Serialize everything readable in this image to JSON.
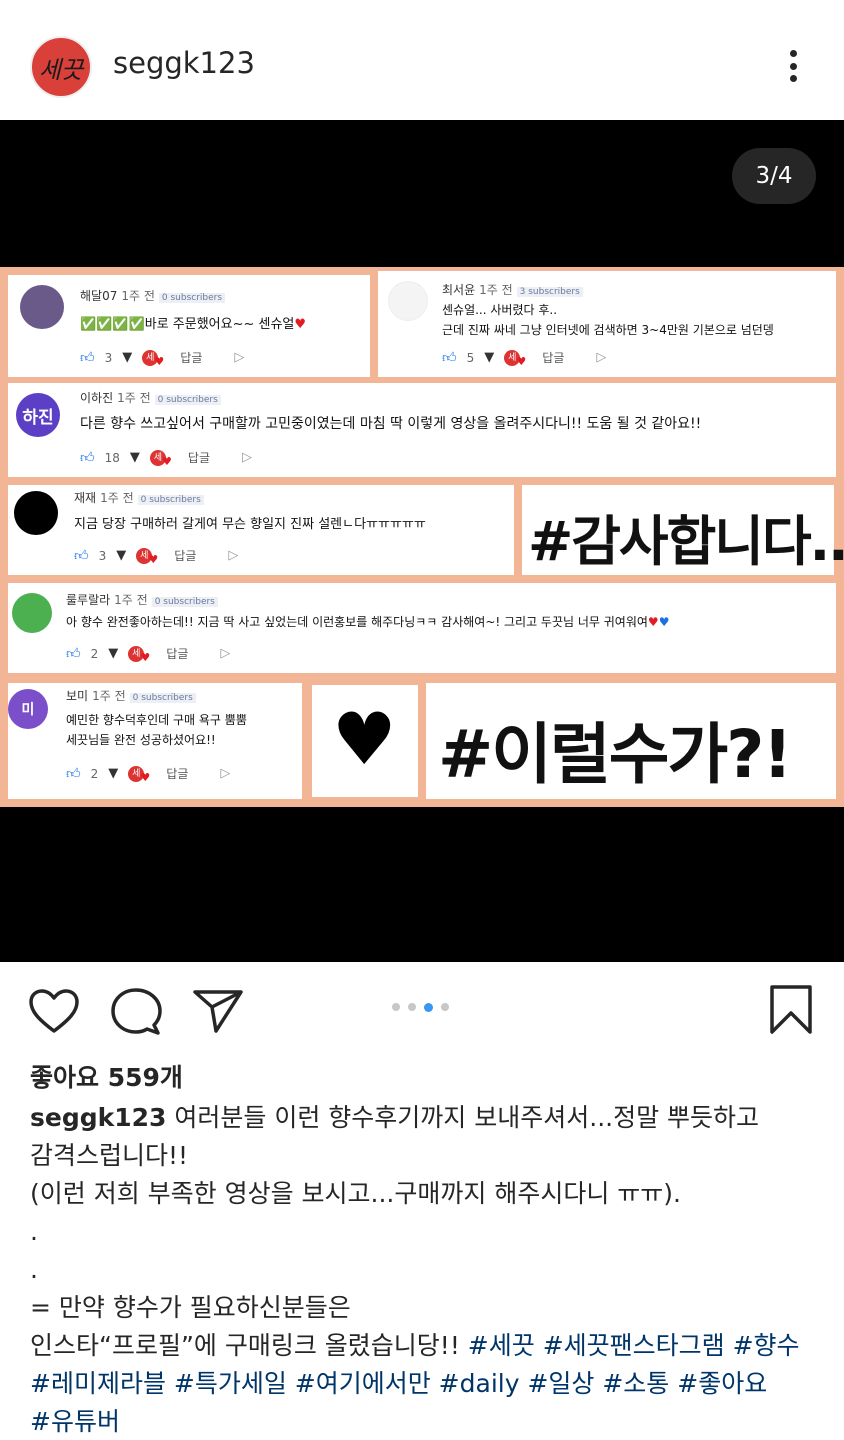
{
  "header": {
    "avatar_text": "세끗",
    "username": "seggk123"
  },
  "media": {
    "counter": "3/4",
    "comments": [
      {
        "name": "해달07",
        "time": "1주 전",
        "subs": "0 subscribers",
        "text": "✅✅✅✅바로 주문했어요~~ 센슈얼",
        "likes": "3",
        "reply": "답글"
      },
      {
        "name": "최서윤",
        "time": "1주 전",
        "subs": "3 subscribers",
        "text": "센슈얼... 사버렸다 후..",
        "text2": "근데 진짜 싸네 그냥 인터넷에 검색하면 3~4만원 기본으로 넘던뎅",
        "likes": "5",
        "reply": "답글"
      },
      {
        "name": "이하진",
        "time": "1주 전",
        "subs": "0 subscribers",
        "avatar": "하진",
        "text": "다른 향수 쓰고싶어서 구매할까 고민중이였는데 마침 딱 이렇게 영상을 올려주시다니!! 도움 될 것 같아요!!",
        "likes": "18",
        "reply": "답글"
      },
      {
        "name": "재재",
        "time": "1주 전",
        "subs": "0 subscribers",
        "text": "지금 당장 구매하러 갈게여 무슨 향일지 진짜 설렌ㄴ다ㅠㅠㅠㅠㅠ",
        "likes": "3",
        "reply": "답글"
      },
      {
        "name": "룰루랄라",
        "time": "1주 전",
        "subs": "0 subscribers",
        "text": "아 향수 완전좋아하는데!! 지금 딱 사고 싶었는데 이런홍보를 해주다닝ㅋㅋ 감사해여~! 그리고 두끗님 너무 귀여워여",
        "likes": "2",
        "reply": "답글"
      },
      {
        "name": "보미",
        "time": "1주 전",
        "subs": "0 subscribers",
        "avatar": "미",
        "text": "예민한 향수덕후인데 구매 욕구 뿜뿜",
        "text2": "세끗님들 완전 성공하셨어요!!",
        "likes": "2",
        "reply": "답글"
      }
    ],
    "tag1": "#감사합니다..",
    "heart": "♥",
    "tag2": "#이럴수가?!"
  },
  "actions": {
    "like_icon": "heart-outline-icon",
    "comment_icon": "comment-bubble-icon",
    "share_icon": "paper-plane-icon",
    "save_icon": "bookmark-icon"
  },
  "likes": "좋아요 559개",
  "caption": {
    "user": "seggk123",
    "line1": " 여러분들 이런 향수후기까지 보내주셔서...정말 뿌듯하고",
    "line2": "감격스럽니다!!",
    "line3": "(이런 저희 부족한 영상을 보시고...구매까지 해주시다니 ㅠㅠ).",
    "line4": ".",
    "line5": ".",
    "line6": "= 만약 향수가 필요하신분들은",
    "line7": "인스타“프로필”에 구매링크 올렸습니당!! ",
    "tags_line7": "#세끗 #세끗팬스타그램 #향수",
    "tags_line8": "#레미제라블 #특가세일 #여기에서만 #daily #일상 #소통 #좋아요",
    "tags_line9": "#유튜버"
  },
  "colors": {
    "collage_bg": "#f2b595",
    "hashtag": "#003569",
    "dot_active": "#3897f0"
  }
}
